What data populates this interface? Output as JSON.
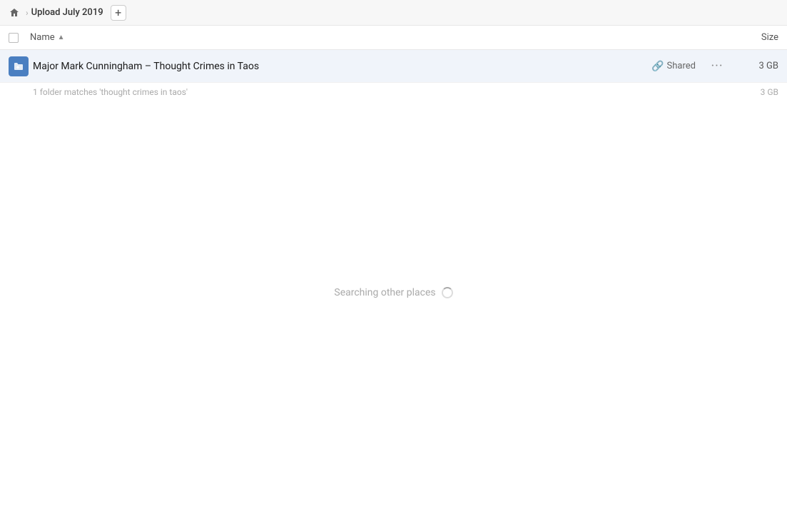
{
  "breadcrumb": {
    "home_icon": "🏠",
    "separator": "›",
    "title": "Upload July 2019",
    "add_icon": "+"
  },
  "columns": {
    "name_label": "Name",
    "size_label": "Size"
  },
  "file_row": {
    "name": "Major Mark Cunningham – Thought Crimes in Taos",
    "shared_label": "Shared",
    "more_icon": "···",
    "size": "3 GB"
  },
  "match_info": {
    "text": "1 folder matches 'thought crimes in taos'",
    "size": "3 GB"
  },
  "searching": {
    "text": "Searching other places"
  }
}
